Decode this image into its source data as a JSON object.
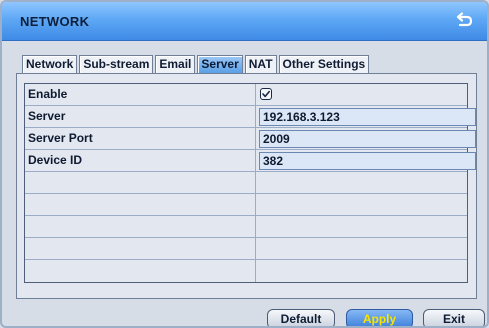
{
  "window": {
    "title": "NETWORK",
    "back_icon": "back-arrow-icon"
  },
  "tabs": [
    {
      "label": "Network",
      "active": false
    },
    {
      "label": "Sub-stream",
      "active": false
    },
    {
      "label": "Email",
      "active": false
    },
    {
      "label": "Server",
      "active": true
    },
    {
      "label": "NAT",
      "active": false
    },
    {
      "label": "Other Settings",
      "active": false
    }
  ],
  "form": {
    "enable": {
      "label": "Enable",
      "checked": true
    },
    "server": {
      "label": "Server",
      "value": "192.168.3.123"
    },
    "server_port": {
      "label": "Server Port",
      "value": "2009"
    },
    "device_id": {
      "label": "Device ID",
      "value": "382"
    }
  },
  "buttons": {
    "default": "Default",
    "apply": "Apply",
    "exit": "Exit"
  },
  "colors": {
    "title_bar": "#5ea8f5",
    "active_tab": "#5b9fe6",
    "apply_text": "#f7e600"
  }
}
